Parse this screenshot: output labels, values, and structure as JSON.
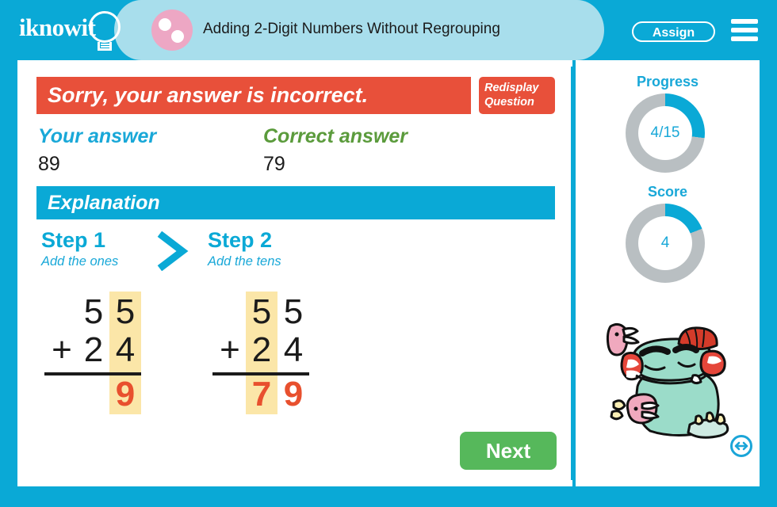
{
  "header": {
    "logo_text": "iknowit",
    "logo_icon": "lightbulb-icon",
    "topic_icon": "two-dot-circle-icon",
    "quiz_title": "Adding 2-Digit Numbers Without Regrouping",
    "assign_label": "Assign",
    "menu_icon": "hamburger-menu-icon"
  },
  "feedback": {
    "message": "Sorry, your answer is incorrect.",
    "redisplay_line1": "Redisplay",
    "redisplay_line2": "Question",
    "banner_color": "#E8503A"
  },
  "answers": {
    "your_label": "Your answer",
    "your_value": "89",
    "your_color": "#19A8D8",
    "correct_label": "Correct answer",
    "correct_value": "79",
    "correct_color": "#5B9B3C"
  },
  "explanation": {
    "heading": "Explanation",
    "chevron_icon": "chevron-right-icon",
    "steps": [
      {
        "title": "Step 1",
        "subtitle": "Add the ones",
        "highlight": "ones",
        "addend1_tens": "5",
        "addend1_ones": "5",
        "operator": "+",
        "addend2_tens": "2",
        "addend2_ones": "4",
        "sum_tens": "",
        "sum_ones": "9"
      },
      {
        "title": "Step 2",
        "subtitle": "Add the tens",
        "highlight": "tens",
        "addend1_tens": "5",
        "addend1_ones": "5",
        "operator": "+",
        "addend2_tens": "2",
        "addend2_ones": "4",
        "sum_tens": "7",
        "sum_ones": "9"
      }
    ],
    "highlight_color": "#FBE6A8",
    "answer_color": "#E8502E"
  },
  "actions": {
    "next_label": "Next",
    "next_color": "#56B85B"
  },
  "sidebar": {
    "progress_label": "Progress",
    "progress_value": "4/15",
    "progress_percent": 27,
    "score_label": "Score",
    "score_value": "4",
    "score_percent": 19,
    "ring_fill_color": "#0AA9D6",
    "ring_track_color": "#B9BFC2",
    "mascot_icon": "monster-mascot-icon",
    "flip_icon": "left-right-arrow-icon"
  },
  "theme": {
    "frame_color": "#0AA9D6",
    "title_pill_color": "#A8DEEC",
    "topic_icon_color": "#EDA7C4"
  }
}
